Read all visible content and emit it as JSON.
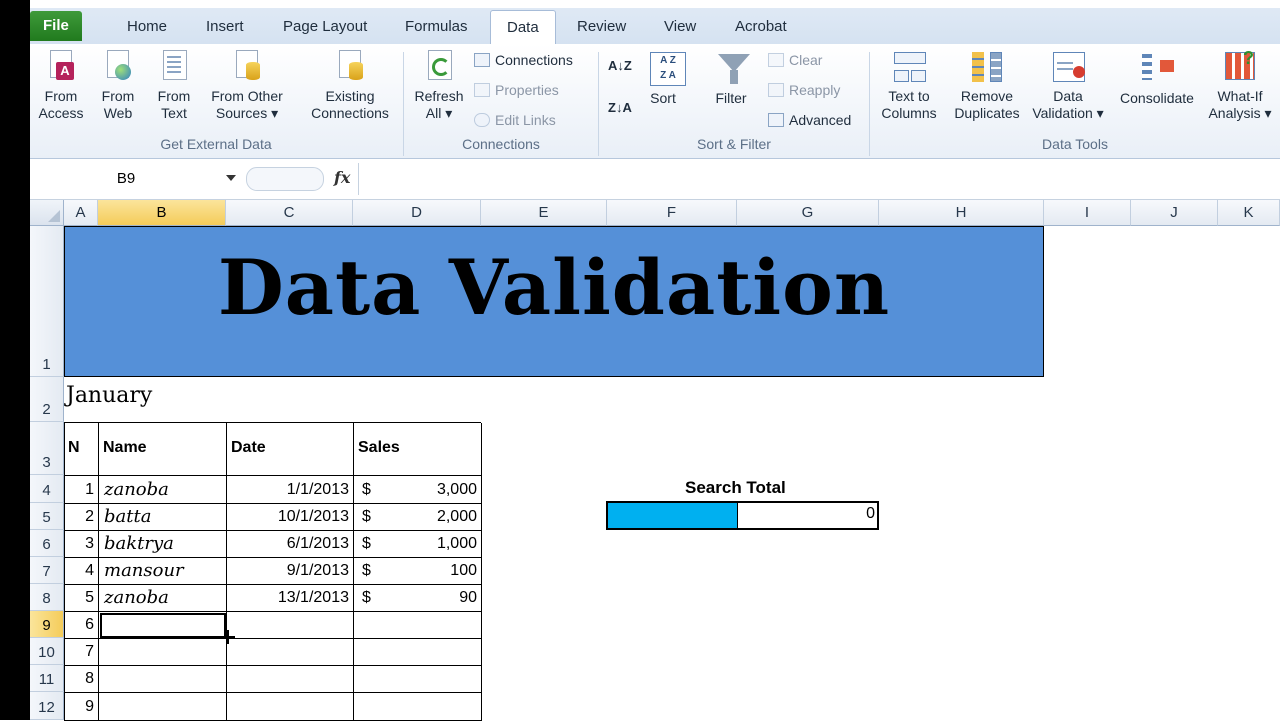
{
  "tabs": [
    {
      "label": "File",
      "x": 0
    },
    {
      "label": "Home",
      "x": 1
    },
    {
      "label": "Insert",
      "x": 2
    },
    {
      "label": "Page Layout",
      "x": 3
    },
    {
      "label": "Formulas",
      "x": 4
    },
    {
      "label": "Data",
      "x": 5
    },
    {
      "label": "Review",
      "x": 6
    },
    {
      "label": "View",
      "x": 7
    },
    {
      "label": "Acrobat",
      "x": 8
    }
  ],
  "ribbon": {
    "get_external": {
      "group_label": "Get External Data",
      "from_access": [
        "From",
        "Access"
      ],
      "from_web": [
        "From",
        "Web"
      ],
      "from_text": [
        "From",
        "Text"
      ],
      "from_other": [
        "From Other",
        "Sources ▾"
      ],
      "existing": [
        "Existing",
        "Connections"
      ]
    },
    "connections": {
      "group_label": "Connections",
      "refresh": [
        "Refresh",
        "All ▾"
      ],
      "connections": "Connections",
      "properties": "Properties",
      "edit_links": "Edit Links"
    },
    "sort_filter": {
      "group_label": "Sort & Filter",
      "sort_az": "A↓Z",
      "sort_za": "Z↓A",
      "sort": "Sort",
      "filter": "Filter",
      "clear": "Clear",
      "reapply": "Reapply",
      "advanced": "Advanced"
    },
    "data_tools": {
      "group_label": "Data Tools",
      "text_to_columns": [
        "Text to",
        "Columns"
      ],
      "remove_duplicates": [
        "Remove",
        "Duplicates"
      ],
      "data_validation": [
        "Data",
        "Validation ▾"
      ],
      "consolidate": "Consolidate",
      "what_if": [
        "What-If",
        "Analysis ▾"
      ]
    }
  },
  "formula_bar": {
    "name_box": "B9",
    "fx": "fx",
    "value": ""
  },
  "columns": [
    "A",
    "B",
    "C",
    "D",
    "E",
    "F",
    "G",
    "H",
    "I",
    "J",
    "K"
  ],
  "rows": [
    "1",
    "2",
    "3",
    "4",
    "5",
    "6",
    "7",
    "8",
    "9",
    "10",
    "11",
    "12"
  ],
  "sheet": {
    "banner": "Data Validation",
    "month": "January",
    "headers": {
      "n": "N",
      "name": "Name",
      "date": "Date",
      "sales": "Sales"
    },
    "records": [
      {
        "n": "1",
        "name": "zanoba",
        "date": "1/1/2013",
        "cur": "$",
        "sales": "3,000"
      },
      {
        "n": "2",
        "name": "batta",
        "date": "10/1/2013",
        "cur": "$",
        "sales": "2,000"
      },
      {
        "n": "3",
        "name": "baktrya",
        "date": "6/1/2013",
        "cur": "$",
        "sales": "1,000"
      },
      {
        "n": "4",
        "name": "mansour",
        "date": "9/1/2013",
        "cur": "$",
        "sales": "100"
      },
      {
        "n": "5",
        "name": "zanoba",
        "date": "13/1/2013",
        "cur": "$",
        "sales": "90"
      },
      {
        "n": "6",
        "name": "",
        "date": "",
        "cur": "",
        "sales": ""
      },
      {
        "n": "7",
        "name": "",
        "date": "",
        "cur": "",
        "sales": ""
      },
      {
        "n": "8",
        "name": "",
        "date": "",
        "cur": "",
        "sales": ""
      },
      {
        "n": "9",
        "name": "",
        "date": "",
        "cur": "",
        "sales": ""
      }
    ],
    "search_total_label": "Search Total",
    "search_total_value": "0"
  },
  "colors": {
    "banner": "#5590d8",
    "search_input": "#00b0f0",
    "selected_header": "#f4cc5a"
  }
}
